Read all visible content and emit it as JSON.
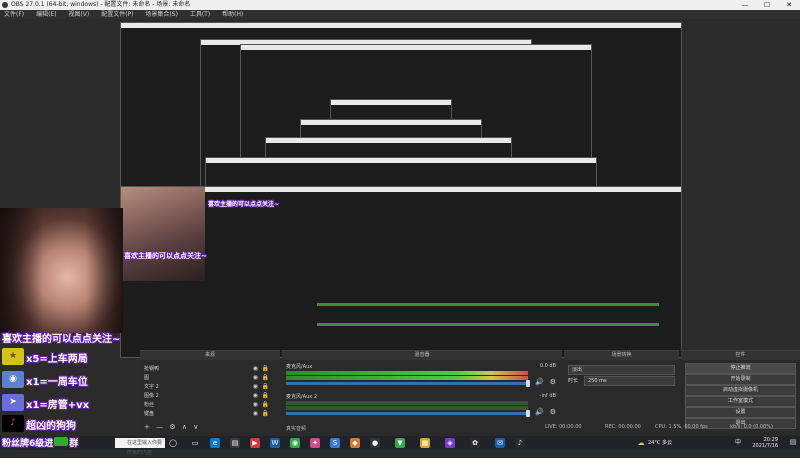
{
  "window": {
    "title": "OBS 27.0.1 (64-bit, windows) - 配置文件: 未命名 - 场景: 未命名",
    "min": "—",
    "max": "☐",
    "close": "✕"
  },
  "menu": [
    "文件(F)",
    "编辑(E)",
    "视图(V)",
    "配置文件(P)",
    "场景集合(S)",
    "工具(T)",
    "帮助(H)"
  ],
  "overlay": {
    "line1": "喜欢主播的可以点点关注~",
    "items": [
      {
        "text": "x5=上车两局",
        "icon": "star-icon",
        "color": "#d4c21b"
      },
      {
        "text": "x1=一周车位",
        "icon": "globe-icon",
        "color": "#5b7fd1"
      },
      {
        "text": "x1=房管+vx",
        "icon": "rocket-icon",
        "color": "#6a6fd8"
      },
      {
        "text": "超凶的狗狗",
        "icon": "tiktok-icon",
        "color": "#000000"
      }
    ],
    "footer": "粉丝牌6级进",
    "footer2": "群"
  },
  "scenes_title": "来源",
  "sources": [
    {
      "name": "抢钢鸭",
      "icon": "▣"
    },
    {
      "name": "图",
      "icon": "▣"
    },
    {
      "name": "文字 2",
      "icon": "T"
    },
    {
      "name": "图像 2",
      "icon": "▣"
    },
    {
      "name": "粉丝",
      "icon": "▣"
    },
    {
      "name": "键盘",
      "icon": "▣"
    }
  ],
  "mixer": {
    "title": "混音器",
    "tracks": [
      {
        "label": "麦克风/Aux",
        "db": "0.0 dB"
      },
      {
        "label": "麦克风/Aux 2",
        "db": "-inf dB"
      }
    ],
    "footer": "真实音频"
  },
  "transitions": {
    "title": "场景转换",
    "type": "淡出",
    "duration_label": "时长",
    "duration_value": "250 ms"
  },
  "controls": {
    "title": "控件",
    "buttons": [
      "停止推流",
      "开始录制",
      "启动虚拟摄像机",
      "工作室模式",
      "设置",
      "退出"
    ]
  },
  "status": {
    "live": "LIVE: 00:00:00",
    "rec": "REC: 00:00:00",
    "cpu": "CPU: 1.5%, 60.00 fps",
    "bitrate": "kb/s: 0.0 (0.00%)"
  },
  "taskbar": {
    "search_placeholder": "在这里输入你要搜索的内容",
    "weather": "24°C 多云",
    "time": "20:29",
    "date": "2021/7/16",
    "lang": "中"
  }
}
